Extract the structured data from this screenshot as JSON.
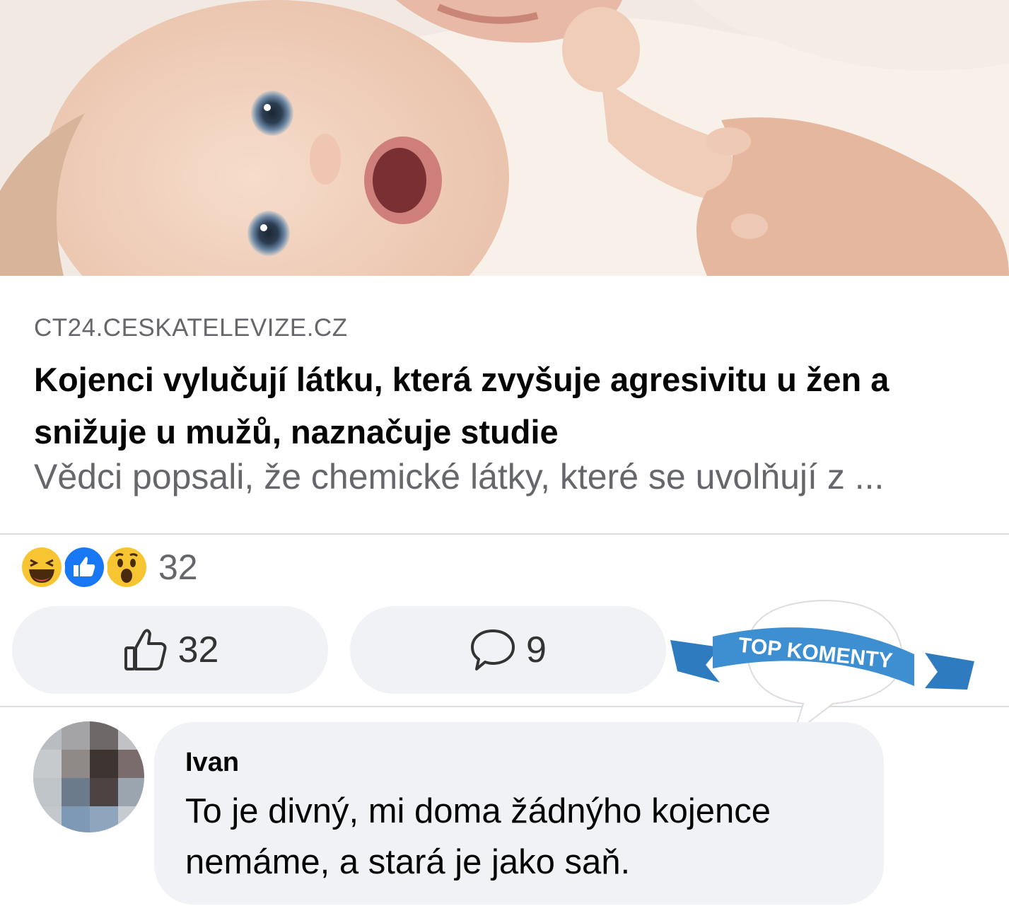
{
  "link_preview": {
    "domain": "CT24.CESKATELEVIZE.CZ",
    "headline": "Kojenci vylučují látku, která zvyšuje agresivitu u žen a snižuje u mužů, naznačuje studie",
    "description": "Vědci popsali, že chemické látky, které se uvolňují z ..."
  },
  "reactions": {
    "icons": [
      "laugh-emoji",
      "like-emoji",
      "wow-emoji"
    ],
    "count": "32"
  },
  "actions": {
    "like_count": "32",
    "comment_count": "9"
  },
  "badge": {
    "label": "TOP KOMENTY",
    "color": "#3d8fd1"
  },
  "comment": {
    "author": "Ivan",
    "text": "To je divný, mi doma žádnýho kojence nemáme, a stará je jako saň."
  },
  "colors": {
    "secondary_text": "#65676b",
    "button_bg": "#f0f2f5",
    "like_blue": "#1877f2"
  }
}
